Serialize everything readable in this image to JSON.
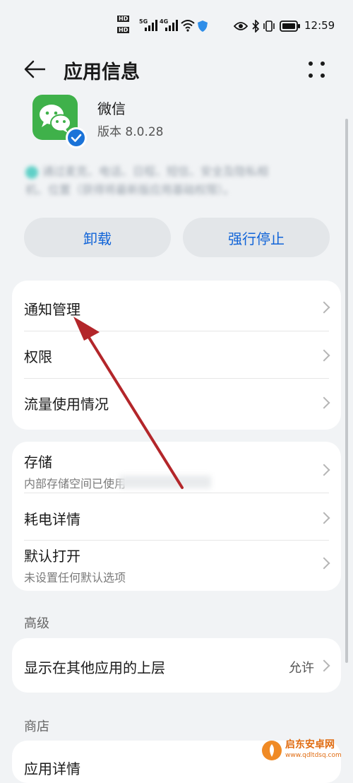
{
  "status_bar": {
    "hd1": "HD",
    "hd2": "HD",
    "net1": "5G",
    "net2": "4G",
    "time": "12:59",
    "icons": [
      "signal-icon",
      "wifi-icon",
      "shield-icon",
      "eye-icon",
      "bluetooth-icon",
      "vibrate-icon",
      "battery-icon"
    ]
  },
  "header": {
    "title": "应用信息",
    "back_icon": "arrow-left-icon",
    "more_icon": "more-dots-icon"
  },
  "app": {
    "name": "微信",
    "version": "版本 8.0.28",
    "icon": "wechat-icon",
    "badge": "verified-badge-icon",
    "blurred_line1": "通过麦克、电话、日程、短信、安全及隐私相",
    "blurred_line2": "机、位置（获得将最新版应用基础权限）。"
  },
  "actions": {
    "uninstall": "卸载",
    "force_stop": "强行停止"
  },
  "group1": [
    {
      "label": "通知管理"
    },
    {
      "label": "权限"
    },
    {
      "label": "流量使用情况"
    }
  ],
  "group2": [
    {
      "label": "存储",
      "sub": "内部存储空间已使用"
    },
    {
      "label": "耗电详情"
    },
    {
      "label": "默认打开",
      "sub": "未设置任何默认选项"
    }
  ],
  "advanced": {
    "header": "高级",
    "item_label": "显示在其他应用的上层",
    "item_value": "允许"
  },
  "store": {
    "header": "商店",
    "item_label": "应用详情"
  },
  "watermark": {
    "name": "启东安卓网",
    "url": "www.qdltdsq.com"
  },
  "colors": {
    "accent": "#1164d8",
    "wechat_green": "#3fb14a",
    "annotation_arrow": "#b3262a"
  }
}
